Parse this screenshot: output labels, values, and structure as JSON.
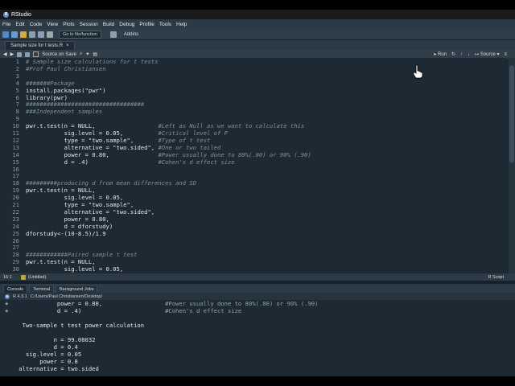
{
  "window": {
    "title": "RStudio"
  },
  "menu": [
    "File",
    "Edit",
    "Code",
    "View",
    "Plots",
    "Session",
    "Build",
    "Debug",
    "Profile",
    "Tools",
    "Help"
  ],
  "toolbar": {
    "goto_placeholder": "Go to file/function",
    "addins": "Addins"
  },
  "editor": {
    "tab_label": "Sample size for t tests.R",
    "source_on_save": "Source on Save",
    "run_label": "Run",
    "source_label": "Source",
    "lines": [
      {
        "n": "1",
        "code": "",
        "comment": "# Sample size calculations for t tests"
      },
      {
        "n": "2",
        "code": "",
        "comment": "#Prof Paul Christiansen"
      },
      {
        "n": "3",
        "code": "",
        "comment": ""
      },
      {
        "n": "4",
        "code": "",
        "comment": "#######Package"
      },
      {
        "n": "5",
        "code": "install.packages(\"pwr\")",
        "comment": ""
      },
      {
        "n": "6",
        "code": "library(pwr)",
        "comment": ""
      },
      {
        "n": "7",
        "code": "",
        "comment": "##################################"
      },
      {
        "n": "8",
        "code": "",
        "comment": "###Independent samples"
      },
      {
        "n": "9",
        "code": "",
        "comment": ""
      },
      {
        "n": "10",
        "code": "pwr.t.test(n = NULL,                  ",
        "comment": "#Left as Null as we want to calculate this"
      },
      {
        "n": "11",
        "code": "           sig.level = 0.05,          ",
        "comment": "#Critical level of P"
      },
      {
        "n": "12",
        "code": "           type = \"two.sample\",       ",
        "comment": "#Type of t test"
      },
      {
        "n": "13",
        "code": "           alternative = \"two.sided\", ",
        "comment": "#One or two tailed"
      },
      {
        "n": "14",
        "code": "           power = 0.80,              ",
        "comment": "#Power usually done to 80%(.80) or 90% (.90)"
      },
      {
        "n": "15",
        "code": "           d = .4)                    ",
        "comment": "#Cohen's d effect size"
      },
      {
        "n": "16",
        "code": "",
        "comment": ""
      },
      {
        "n": "17",
        "code": "",
        "comment": ""
      },
      {
        "n": "18",
        "code": "",
        "comment": "#########producing d from mean differences and SD"
      },
      {
        "n": "19",
        "code": "pwr.t.test(n = NULL,",
        "comment": ""
      },
      {
        "n": "20",
        "code": "           sig.level = 0.05,",
        "comment": ""
      },
      {
        "n": "21",
        "code": "           type = \"two.sample\",",
        "comment": ""
      },
      {
        "n": "22",
        "code": "           alternative = \"two.sided\",",
        "comment": ""
      },
      {
        "n": "23",
        "code": "           power = 0.80,",
        "comment": ""
      },
      {
        "n": "24",
        "code": "           d = dforstudy)",
        "comment": ""
      },
      {
        "n": "25",
        "code": "dforstudy<-(10-8.5)/1.9",
        "comment": ""
      },
      {
        "n": "26",
        "code": "",
        "comment": ""
      },
      {
        "n": "27",
        "code": "",
        "comment": ""
      },
      {
        "n": "28",
        "code": "",
        "comment": "############Paired sample t test"
      },
      {
        "n": "29",
        "code": "pwr.t.test(n = NULL,",
        "comment": ""
      },
      {
        "n": "30",
        "code": "           sig.level = 0.05,",
        "comment": ""
      }
    ],
    "status_pos": "16:1",
    "status_scope": "(Untitled)",
    "status_type": "R Script"
  },
  "console": {
    "tabs": [
      "Console",
      "Terminal",
      "Background Jobs"
    ],
    "r_version": "R 4.3.1",
    "path": "C:/Users/Paul Christiansen/Desktop/",
    "lines": [
      {
        "code": "+              power = 0.80,                  ",
        "comment": "#Power usually done to 80%(.80) or 90% (.90)"
      },
      {
        "code": "+              d = .4)                        ",
        "comment": "#Cohen's d effect size"
      },
      {
        "code": "",
        "comment": ""
      },
      {
        "code": "     Two-sample t test power calculation",
        "comment": ""
      },
      {
        "code": "",
        "comment": ""
      },
      {
        "code": "              n = 99.08032",
        "comment": ""
      },
      {
        "code": "              d = 0.4",
        "comment": ""
      },
      {
        "code": "      sig.level = 0.05",
        "comment": ""
      },
      {
        "code": "          power = 0.8",
        "comment": ""
      },
      {
        "code": "    alternative = two.sided",
        "comment": ""
      }
    ]
  }
}
